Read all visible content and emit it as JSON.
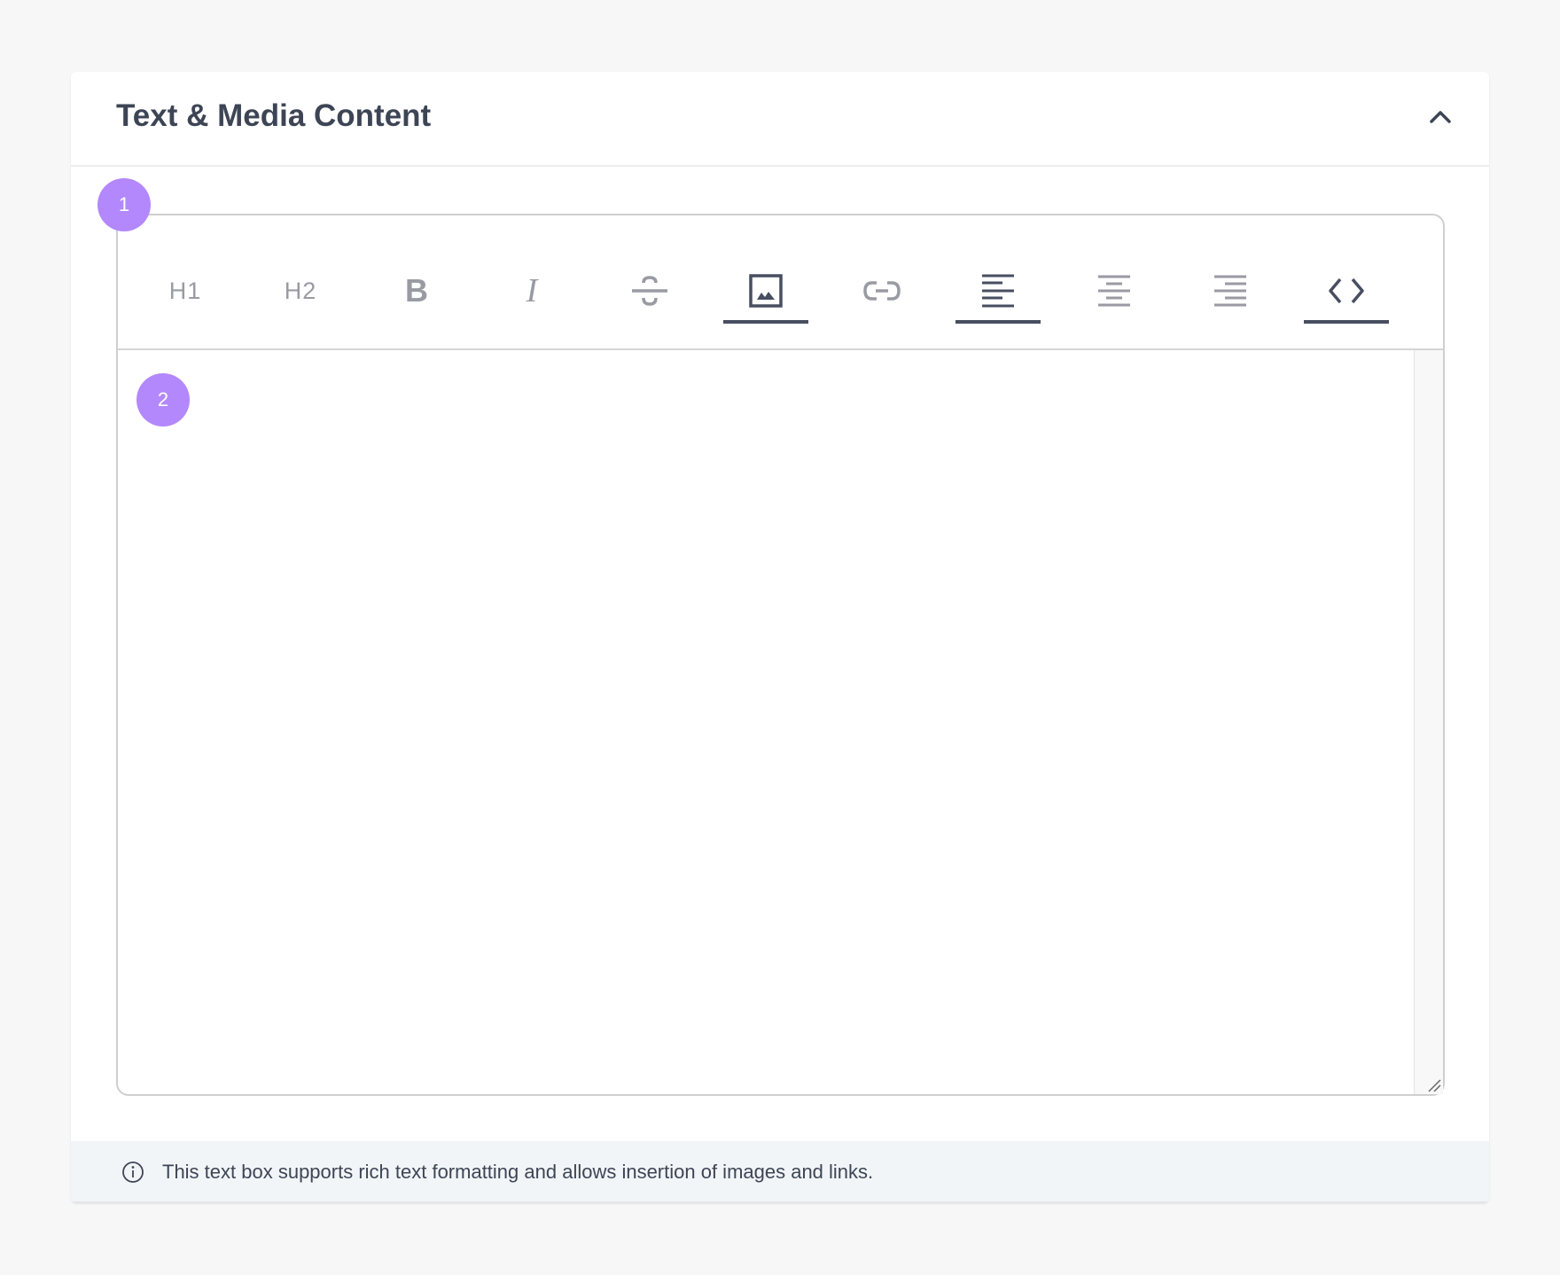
{
  "panel": {
    "title": "Text & Media Content",
    "collapse_icon": "chevron-up-icon"
  },
  "toolbar": {
    "items": [
      {
        "name": "heading-1",
        "label": "H1",
        "active": false
      },
      {
        "name": "heading-2",
        "label": "H2",
        "active": false
      },
      {
        "name": "bold",
        "label": "B",
        "active": false
      },
      {
        "name": "italic",
        "label": "I",
        "active": false
      },
      {
        "name": "strikethrough",
        "icon": "strikethrough-icon",
        "active": false
      },
      {
        "name": "image",
        "icon": "image-icon",
        "active": true
      },
      {
        "name": "link",
        "icon": "link-icon",
        "active": false
      },
      {
        "name": "align-left",
        "icon": "align-left-icon",
        "active": true
      },
      {
        "name": "align-center",
        "icon": "align-center-icon",
        "active": false
      },
      {
        "name": "align-right",
        "icon": "align-right-icon",
        "active": false
      },
      {
        "name": "code",
        "icon": "code-icon",
        "active": true
      }
    ]
  },
  "editor": {
    "content": ""
  },
  "badges": [
    "1",
    "2"
  ],
  "footer": {
    "text": "This text box supports rich text formatting and allows insertion of images and links."
  },
  "colors": {
    "badge": "#b388fc",
    "active": "#474e60",
    "inactive": "#9a9aa3",
    "footer_bg": "#f2f5f8"
  }
}
